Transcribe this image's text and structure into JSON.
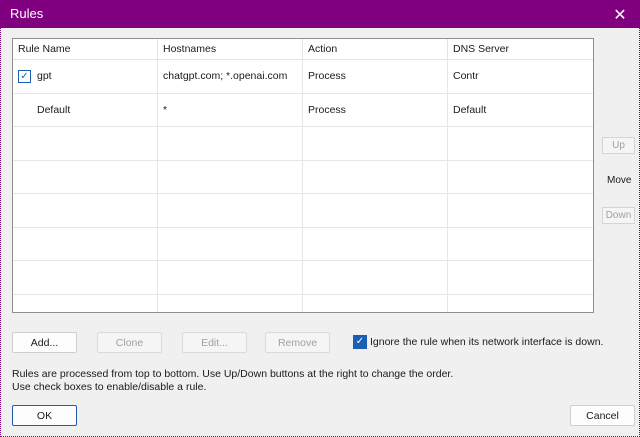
{
  "window": {
    "title": "Rules",
    "close_glyph": "✕"
  },
  "table": {
    "columns": [
      "Rule Name",
      "Hostnames",
      "Action",
      "DNS Server"
    ],
    "rows": [
      {
        "checked": true,
        "name": "gpt",
        "hostnames": "chatgpt.com; *.openai.com",
        "action": "Process",
        "dns": "Contr"
      },
      {
        "checked": null,
        "name": "Default",
        "hostnames": "*",
        "action": "Process",
        "dns": "Default"
      }
    ]
  },
  "side": {
    "up_label": "Up",
    "move_label": "Move",
    "down_label": "Down"
  },
  "buttons": {
    "add": "Add...",
    "clone": "Clone",
    "edit": "Edit...",
    "remove": "Remove",
    "ok": "OK",
    "cancel": "Cancel"
  },
  "option": {
    "checked": true,
    "label": "Ignore the rule when its network interface is down."
  },
  "hint": {
    "line1": "Rules are processed from top to bottom. Use Up/Down buttons at the right to change the order.",
    "line2": "Use check boxes to enable/disable a rule."
  },
  "colors": {
    "titlebar": "#800080",
    "accent": "#1a5fb4"
  }
}
